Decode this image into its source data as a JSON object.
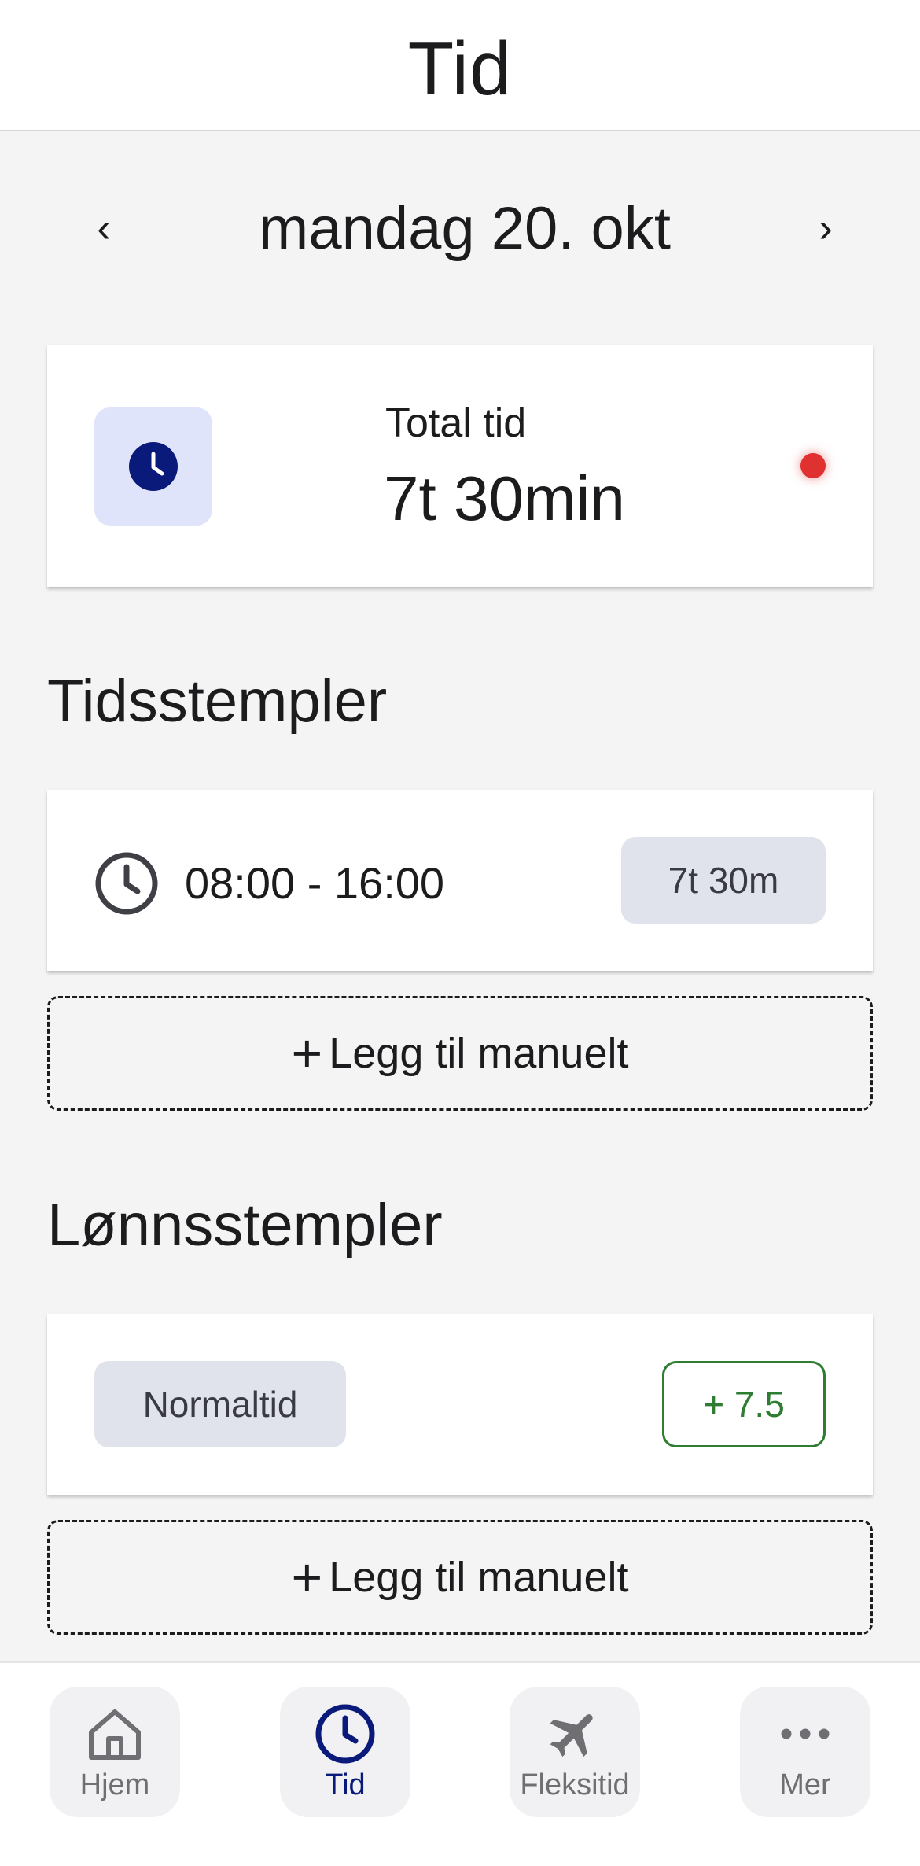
{
  "header": {
    "title": "Tid"
  },
  "date_nav": {
    "prev": "‹",
    "date": "mandag 20. okt",
    "next": "›"
  },
  "total": {
    "label": "Total tid",
    "value": "7t 30min"
  },
  "timestamps": {
    "title": "Tidsstempler",
    "entries": [
      {
        "range": "08:00 - 16:00",
        "duration": "7t 30m"
      }
    ],
    "add_label": "Legg til manuelt"
  },
  "payroll": {
    "title": "Lønnsstempler",
    "entries": [
      {
        "type": "Normaltid",
        "hours": "+ 7.5"
      }
    ],
    "add_label": "Legg til manuelt"
  },
  "tabbar": {
    "tabs": [
      {
        "label": "Hjem",
        "icon": "home-icon"
      },
      {
        "label": "Tid",
        "icon": "clock-icon"
      },
      {
        "label": "Fleksitid",
        "icon": "airplane-icon"
      },
      {
        "label": "Mer",
        "icon": "more-icon"
      }
    ],
    "active": "Tid"
  },
  "colors": {
    "accent": "#0a1a7a",
    "accent_bg": "#e0e4fb",
    "recording": "#e03131",
    "positive": "#2e7d32",
    "pill_bg": "#e1e3ec",
    "background": "#f4f4f4"
  }
}
